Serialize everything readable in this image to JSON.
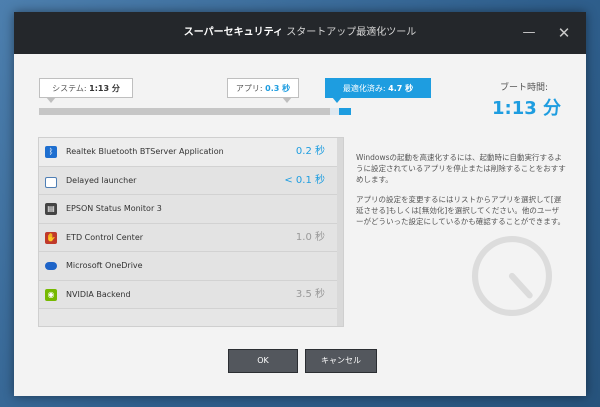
{
  "window": {
    "title_brand": "スーパーセキュリティ",
    "title_tool": "スタートアップ最適化ツール",
    "minimize_glyph": "—",
    "close_glyph": "✕"
  },
  "summary": {
    "system_label": "システム:",
    "system_value": "1:13 分",
    "apps_label": "アプリ:",
    "apps_value": "0.3 秒",
    "optimized_label": "最適化済み:",
    "optimized_value": "4.7 秒",
    "boot_label": "ブート時間:",
    "boot_value": "1:13 分"
  },
  "apps": [
    {
      "name": "Realtek Bluetooth BTServer Application",
      "time": "0.2 秒",
      "icon": "bluetooth-icon",
      "time_color": "#1e9de0"
    },
    {
      "name": "Delayed launcher",
      "time": "< 0.1 秒",
      "icon": "launcher-icon",
      "time_color": "#1e9de0"
    },
    {
      "name": "EPSON Status Monitor 3",
      "time": "",
      "icon": "printer-icon",
      "time_color": "#999999"
    },
    {
      "name": "ETD Control Center",
      "time": "1.0 秒",
      "icon": "touchpad-icon",
      "time_color": "#999999"
    },
    {
      "name": "Microsoft OneDrive",
      "time": "",
      "icon": "cloud-icon",
      "time_color": "#999999"
    },
    {
      "name": "NVIDIA Backend",
      "time": "3.5 秒",
      "icon": "nvidia-icon",
      "time_color": "#999999"
    }
  ],
  "description": {
    "p1": "Windowsの起動を高速化するには、起動時に自動実行するように設定されているアプリを停止または削除することをおすすめします。",
    "p2": "アプリの設定を変更するにはリストからアプリを選択して[遅延させる]もしくは[無効化]を選択してください。他のユーザーがどういった設定にしているかも確認することができます。"
  },
  "buttons": {
    "ok": "OK",
    "cancel": "キャンセル"
  },
  "colors": {
    "accent": "#1e9de0",
    "titlebar": "#24272b"
  }
}
